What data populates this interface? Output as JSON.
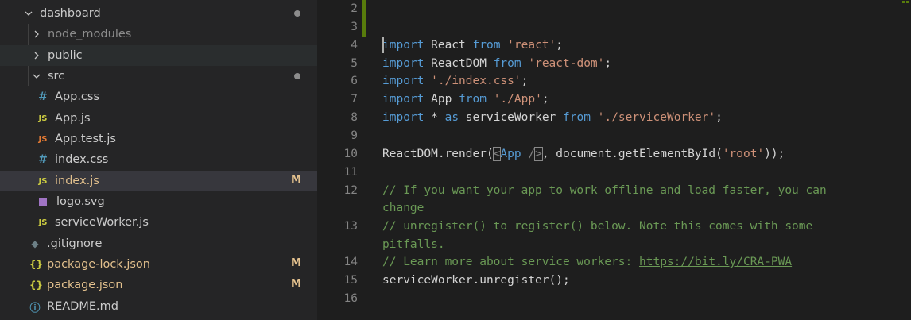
{
  "explorer": {
    "items": [
      {
        "label": "dashboard",
        "type": "folder-open",
        "depth": 0,
        "dot": true
      },
      {
        "label": "node_modules",
        "type": "folder",
        "depth": 1,
        "dim": true
      },
      {
        "label": "public",
        "type": "folder",
        "depth": 1
      },
      {
        "label": "src",
        "type": "folder-open",
        "depth": 1,
        "dot": true
      },
      {
        "label": "App.css",
        "type": "css",
        "icon_text": "#"
      },
      {
        "label": "App.js",
        "type": "js",
        "icon_text": "JS"
      },
      {
        "label": "App.test.js",
        "type": "jstest",
        "icon_text": "JS"
      },
      {
        "label": "index.css",
        "type": "css",
        "icon_text": "#"
      },
      {
        "label": "index.js",
        "type": "js",
        "icon_text": "JS",
        "badge": "M",
        "selected": true
      },
      {
        "label": "logo.svg",
        "type": "svg"
      },
      {
        "label": "serviceWorker.js",
        "type": "js",
        "icon_text": "JS"
      },
      {
        "label": ".gitignore",
        "type": "git",
        "icon_text": "◆"
      },
      {
        "label": "package-lock.json",
        "type": "json",
        "icon_text": "{}",
        "badge": "M"
      },
      {
        "label": "package.json",
        "type": "json",
        "icon_text": "{}",
        "badge": "M"
      },
      {
        "label": "README.md",
        "type": "info",
        "icon_text": "ⓘ"
      }
    ]
  },
  "editor": {
    "line_numbers": [
      "2",
      "3",
      "4",
      "5",
      "6",
      "7",
      "8",
      "9",
      "10",
      "11",
      "12",
      "",
      "13",
      "",
      "14",
      "15",
      "16"
    ],
    "lines": {
      "l4": {
        "kw": "import",
        "name": " React ",
        "from": "from",
        "str": "'react'",
        "end": ";"
      },
      "l5": {
        "kw": "import",
        "name": " ReactDOM ",
        "from": "from",
        "str": "'react-dom'",
        "end": ";"
      },
      "l6": {
        "kw": "import",
        "sp": " ",
        "str": "'./index.css'",
        "end": ";"
      },
      "l7": {
        "kw": "import",
        "name": " App ",
        "from": "from",
        "str": "'./App'",
        "end": ";"
      },
      "l8": {
        "kw": "import",
        "star": " * ",
        "as": "as",
        "name": " serviceWorker ",
        "from": "from",
        "str": "'./serviceWorker'",
        "end": ";"
      },
      "l10": {
        "a": "ReactDOM.render(",
        "lt": "<",
        "tag": "App",
        "sp": " /",
        "gt": ">",
        "b": ", document.getElementById(",
        "str": "'root'",
        "c": "));"
      },
      "l12a": "// If you want your app to work offline and load faster, you can",
      "l12b": "change",
      "l13a": "// unregister() to register() below. Note this comes with some",
      "l13b": "pitfalls.",
      "l14": {
        "text": "// Learn more about service workers: ",
        "link": "https://bit.ly/CRA-PWA"
      },
      "l15": "serviceWorker.unregister();"
    }
  },
  "colors": {
    "sidebar_bg": "#252526",
    "editor_bg": "#1e1e1e",
    "keyword": "#569cd6",
    "string": "#ce9178",
    "comment": "#6a9955",
    "modified": "#e2c08d"
  }
}
